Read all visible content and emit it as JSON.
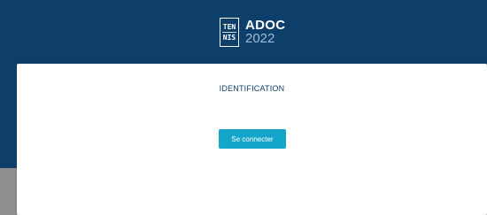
{
  "header": {
    "logo": {
      "line1": "TEN",
      "line2": "NIS",
      "title": "ADOC",
      "year": "2022"
    }
  },
  "card": {
    "title": "IDENTIFICATION",
    "connect_label": "Se connecter"
  },
  "colors": {
    "header_background": "#0e3f6b",
    "button_background": "#14a6c9",
    "title_text": "#0e3f6b"
  }
}
